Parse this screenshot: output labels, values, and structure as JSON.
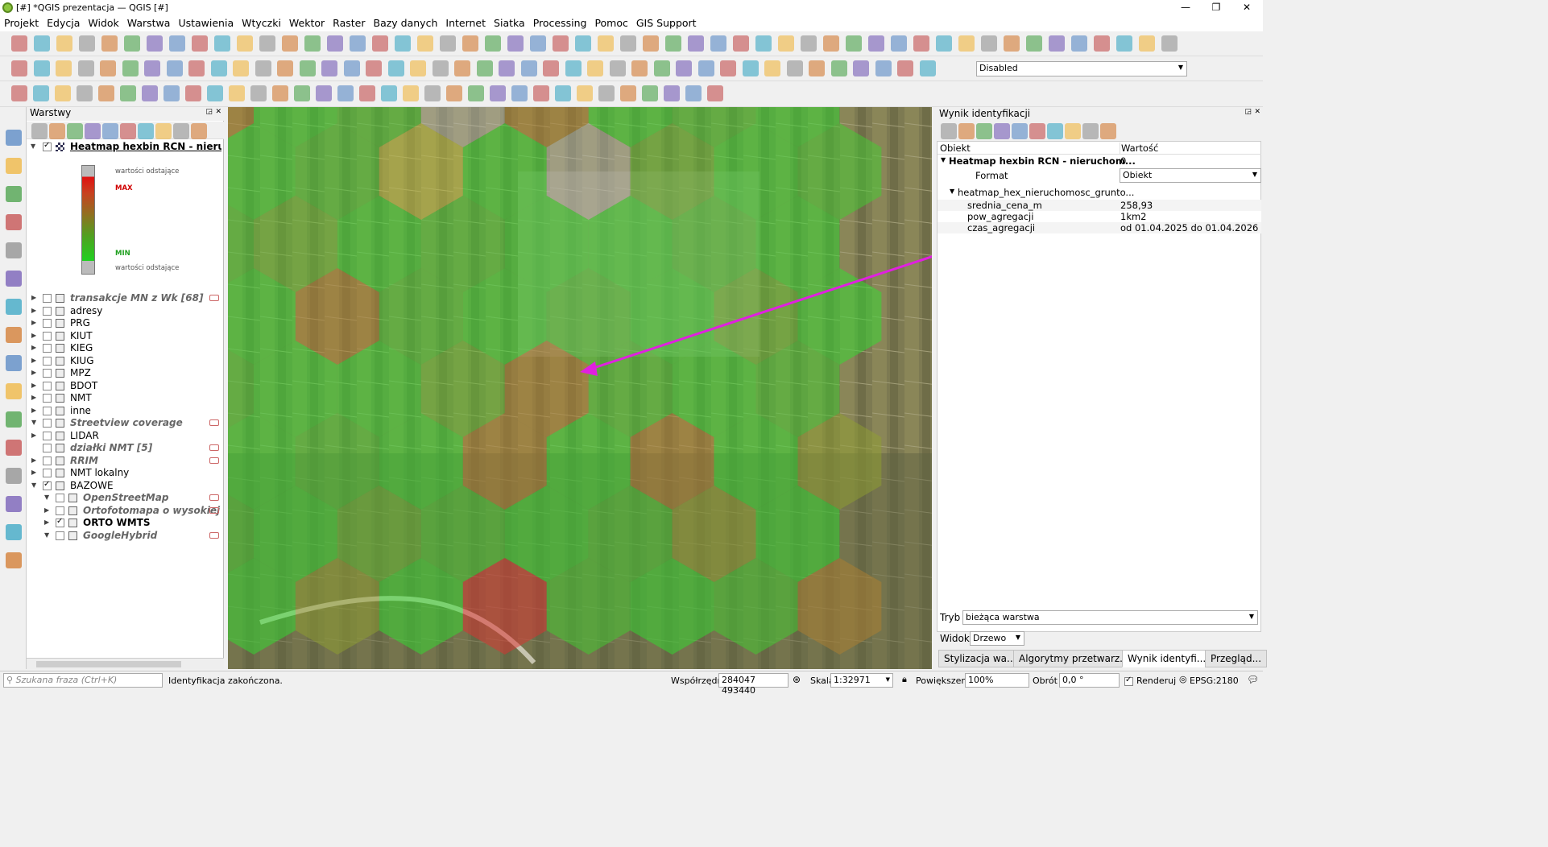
{
  "window": {
    "title": "[#] *QGIS prezentacja — QGIS [#]",
    "min": "—",
    "max": "❐",
    "close": "✕"
  },
  "menu": [
    "Projekt",
    "Edycja",
    "Widok",
    "Warstwa",
    "Ustawienia",
    "Wtyczki",
    "Wektor",
    "Raster",
    "Bazy danych",
    "Internet",
    "Siatka",
    "Processing",
    "Pomoc",
    "GIS Support"
  ],
  "toolbar": {
    "digitizing_select": "Disabled"
  },
  "layers_panel": {
    "title": "Warstwy",
    "heatmap_layer": "Heatmap hexbin RCN - nieruchomości gruntowe",
    "legend": {
      "outlier_top": "wartości odstające",
      "max": "MAX",
      "min": "MIN",
      "outlier_bottom": "wartości odstające",
      "max_color": "#d00000",
      "min_color": "#20c020"
    },
    "items": [
      {
        "label": "transakcje MN z Wk [68]",
        "style": "italic"
      },
      {
        "label": "adresy"
      },
      {
        "label": "PRG"
      },
      {
        "label": "KIUT"
      },
      {
        "label": "KIEG"
      },
      {
        "label": "KIUG"
      },
      {
        "label": "MPZ"
      },
      {
        "label": "BDOT"
      },
      {
        "label": "NMT"
      },
      {
        "label": "inne"
      },
      {
        "label": "Streetview coverage",
        "style": "italic"
      },
      {
        "label": "LIDAR"
      },
      {
        "label": "działki NMT [5]",
        "style": "italic"
      },
      {
        "label": "RRIM",
        "style": "italic"
      },
      {
        "label": "NMT lokalny"
      },
      {
        "label": "BAZOWE",
        "checked": true
      },
      {
        "label": "OpenStreetMap",
        "style": "italic"
      },
      {
        "label": "Ortofotomapa o wysokiej rozdzielczości",
        "style": "italic"
      },
      {
        "label": "ORTO WMTS",
        "checked": true,
        "style": "bold"
      },
      {
        "label": "GoogleHybrid",
        "style": "italic"
      }
    ]
  },
  "ident_panel": {
    "title": "Wynik identyfikacji",
    "col_object": "Obiekt",
    "col_value": "Wartość",
    "layer_row": {
      "name": "Heatmap hexbin RCN - nieruchom...",
      "value": "0"
    },
    "format_label": "Format",
    "format_value": "Obiekt",
    "feature_row": "heatmap_hex_nieruchomosc_grunto...",
    "attributes": [
      {
        "name": "srednia_cena_m",
        "value": "258,93"
      },
      {
        "name": "pow_agregacji",
        "value": "1km2"
      },
      {
        "name": "czas_agregacji",
        "value": "od 01.04.2025 do 01.04.2026"
      }
    ],
    "mode_label": "Tryb",
    "mode_value": "bieżąca warstwa",
    "view_label": "Widok",
    "view_value": "Drzewo",
    "tabs": [
      "Stylizacja wa...",
      "Algorytmy przetwarz...",
      "Wynik identyfi...",
      "Przegląd..."
    ]
  },
  "statusbar": {
    "search_placeholder": "Szukana fraza (Ctrl+K)",
    "message": "Identyfikacja zakończona.",
    "coord_label": "Współrzędne",
    "coord_value": "284047  493440",
    "scale_label": "Skala",
    "scale_value": "1:32971",
    "zoom_label": "Powiększenie",
    "zoom_value": "100%",
    "rotation_label": "Obrót",
    "rotation_value": "0,0 °",
    "render_label": "Renderuj",
    "crs": "EPSG:2180"
  },
  "map": {
    "annotation_arrow_color": "#e020e0"
  }
}
